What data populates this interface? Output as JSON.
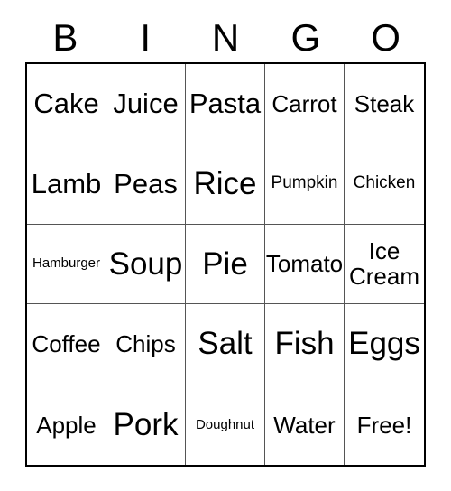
{
  "card": {
    "title": "BINGO",
    "header_letters": [
      "B",
      "I",
      "N",
      "G",
      "O"
    ],
    "free_space_label": "Free!",
    "colors": {
      "background": "#ffffff",
      "text": "#000000",
      "outer_border": "#000000",
      "inner_gridline": "#555555"
    },
    "grid": {
      "rows": 5,
      "columns": 5,
      "cells": [
        {
          "text": "Cake",
          "size": "lg"
        },
        {
          "text": "Juice",
          "size": "lg"
        },
        {
          "text": "Pasta",
          "size": "lg"
        },
        {
          "text": "Carrot",
          "size": "md"
        },
        {
          "text": "Steak",
          "size": "md"
        },
        {
          "text": "Lamb",
          "size": "lg"
        },
        {
          "text": "Peas",
          "size": "lg"
        },
        {
          "text": "Rice",
          "size": "xl"
        },
        {
          "text": "Pumpkin",
          "size": "sm"
        },
        {
          "text": "Chicken",
          "size": "sm"
        },
        {
          "text": "Hamburger",
          "size": "xs"
        },
        {
          "text": "Soup",
          "size": "xl"
        },
        {
          "text": "Pie",
          "size": "xl"
        },
        {
          "text": "Tomato",
          "size": "md"
        },
        {
          "text": "Ice\nCream",
          "size": "md"
        },
        {
          "text": "Coffee",
          "size": "md"
        },
        {
          "text": "Chips",
          "size": "md"
        },
        {
          "text": "Salt",
          "size": "xl"
        },
        {
          "text": "Fish",
          "size": "xl"
        },
        {
          "text": "Eggs",
          "size": "xl"
        },
        {
          "text": "Apple",
          "size": "md"
        },
        {
          "text": "Pork",
          "size": "xl"
        },
        {
          "text": "Doughnut",
          "size": "xs"
        },
        {
          "text": "Water",
          "size": "md"
        },
        {
          "text": "Free!",
          "size": "md"
        }
      ]
    }
  }
}
